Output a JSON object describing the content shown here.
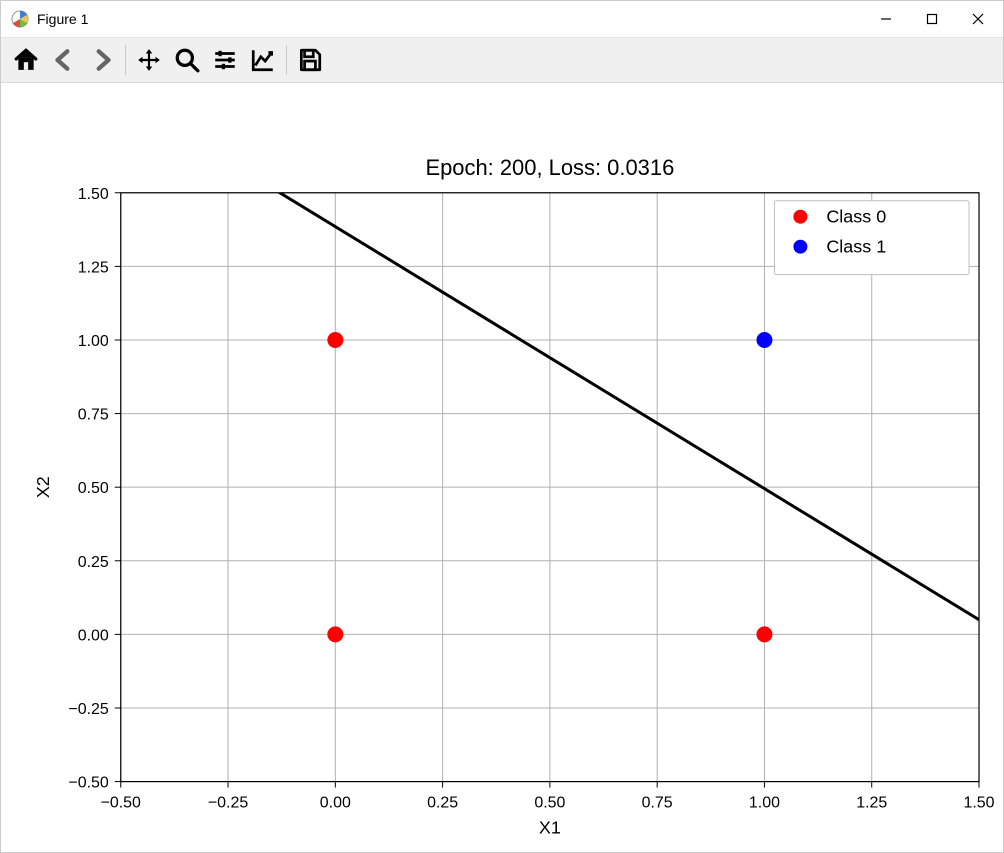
{
  "window": {
    "title": "Figure 1"
  },
  "chart_data": {
    "type": "scatter",
    "title": "Epoch: 200, Loss: 0.0316",
    "xlabel": "X1",
    "ylabel": "X2",
    "xlim": [
      -0.5,
      1.5
    ],
    "ylim": [
      -0.5,
      1.5
    ],
    "xticks": [
      -0.5,
      -0.25,
      0.0,
      0.25,
      0.5,
      0.75,
      1.0,
      1.25,
      1.5
    ],
    "yticks": [
      -0.5,
      -0.25,
      0.0,
      0.25,
      0.5,
      0.75,
      1.0,
      1.25,
      1.5
    ],
    "grid": true,
    "series": [
      {
        "name": "Class 0",
        "color": "#ff0000",
        "points": [
          [
            0,
            0
          ],
          [
            0,
            1
          ],
          [
            1,
            0
          ]
        ]
      },
      {
        "name": "Class 1",
        "color": "#0000ff",
        "points": [
          [
            1,
            1
          ]
        ]
      }
    ],
    "line": {
      "x": [
        -0.5,
        1.5
      ],
      "y": [
        1.83,
        0.05
      ],
      "color": "#000000",
      "width": 3
    },
    "legend_position": "upper right"
  }
}
